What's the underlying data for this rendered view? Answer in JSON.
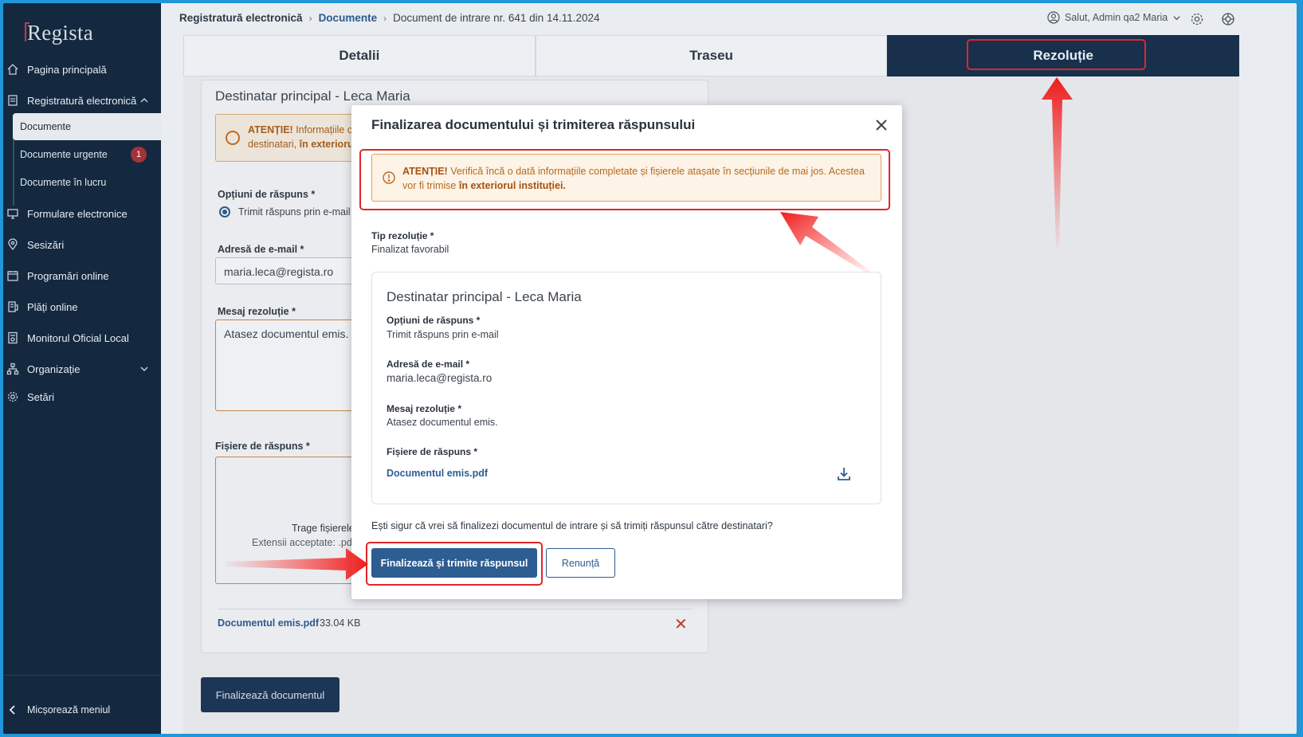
{
  "app": {
    "logo": "Regista"
  },
  "sidebar": {
    "items": [
      {
        "label": "Pagina principală",
        "icon": "home-icon"
      },
      {
        "label": "Registratură electronică",
        "icon": "document-icon"
      },
      {
        "label": "Formulare electronice",
        "icon": "monitor-icon"
      },
      {
        "label": "Sesizări",
        "icon": "location-pin-icon"
      },
      {
        "label": "Programări online",
        "icon": "calendar-icon"
      },
      {
        "label": "Plăți online",
        "icon": "payment-icon"
      },
      {
        "label": "Monitorul Oficial Local",
        "icon": "official-doc-icon"
      },
      {
        "label": "Organizație",
        "icon": "org-chart-icon"
      },
      {
        "label": "Setări",
        "icon": "gear-icon"
      }
    ],
    "sub_items": [
      {
        "label": "Documente"
      },
      {
        "label": "Documente urgente",
        "badge": "1"
      },
      {
        "label": "Documente în lucru"
      }
    ],
    "collapse_label": "Micșorează meniul"
  },
  "header": {
    "breadcrumb": [
      "Registratură electronică",
      "Documente",
      "Document de intrare nr. 641 din 14.11.2024"
    ],
    "user_label": "Salut, Admin qa2 Maria"
  },
  "tabs": [
    {
      "label": "Detalii"
    },
    {
      "label": "Traseu"
    },
    {
      "label": "Rezoluție"
    }
  ],
  "background_form": {
    "title": "Destinatar principal - Leca Maria",
    "alert_strong": "ATENȚIE!",
    "alert_line1": "Informațiile com",
    "alert_line2_a": "destinatari, ",
    "alert_line2_b": "în exteriorul in",
    "options_label": "Opțiuni de răspuns *",
    "option_value": "Trimit răspuns prin e-mail",
    "email_label": "Adresă de e-mail *",
    "email_value": "maria.leca@regista.ro",
    "message_label": "Mesaj rezoluție *",
    "message_value": "Atasez documentul emis.",
    "files_label": "Fișiere de răspuns *",
    "drop_text": "Trage fișierele",
    "drop_ext": "Extensii acceptate: .pdf,",
    "file_name": "Documentul emis.pdf",
    "file_size": "33.04 KB",
    "finalize_button": "Finalizează documentul"
  },
  "modal": {
    "title": "Finalizarea documentului și trimiterea răspunsului",
    "alert_strong": "ATENȚIE!",
    "alert_text": "Verifică încă o dată informațiile completate și fișierele atașate în secțiunile de mai jos. Acestea vor fi trimise",
    "alert_bold_end": "în exteriorul instituției.",
    "resolution_type_label": "Tip rezoluție *",
    "resolution_type_value": "Finalizat favorabil",
    "card_title": "Destinatar principal - Leca Maria",
    "options_label": "Opțiuni de răspuns *",
    "options_value": "Trimit răspuns prin e-mail",
    "email_label": "Adresă de e-mail *",
    "email_value": "maria.leca@regista.ro",
    "message_label": "Mesaj rezoluție *",
    "message_value": "Atasez documentul emis.",
    "files_label": "Fișiere de răspuns *",
    "file_name": "Documentul emis.pdf",
    "question": "Ești sigur că vrei să finalizezi documentul de intrare și să trimiți răspunsul către destinatari?",
    "confirm_button": "Finalizează și trimite răspunsul",
    "cancel_button": "Renunță"
  },
  "colors": {
    "sidebar_bg": "#14293f",
    "primary": "#2e5d92",
    "highlight": "#e0262c",
    "warning": "#b66a1c"
  }
}
